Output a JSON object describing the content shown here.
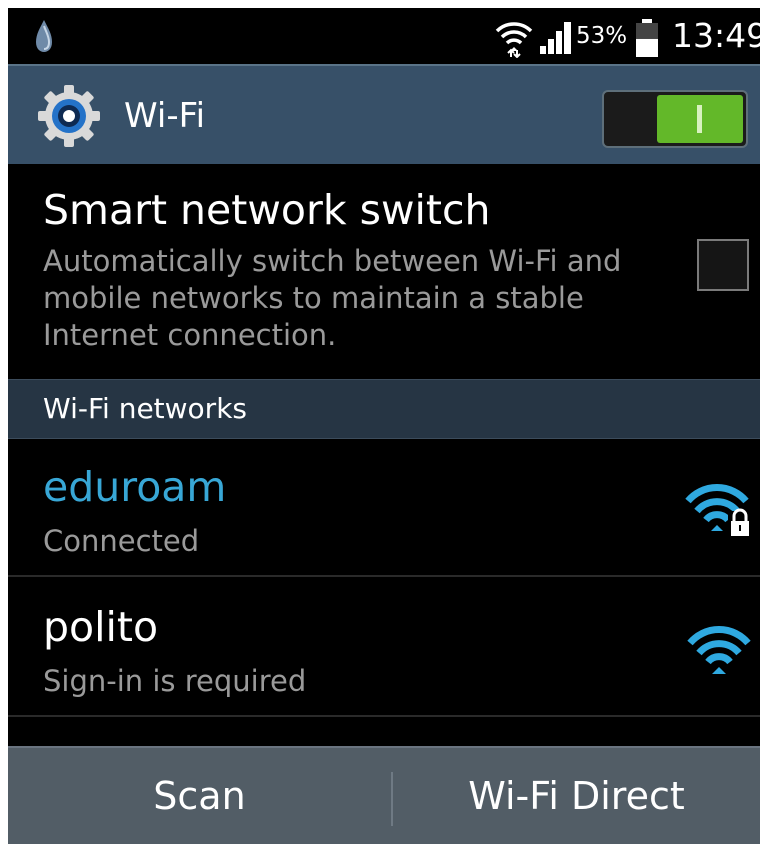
{
  "status_bar": {
    "notification_icon": "notification-drop-icon",
    "wifi_icon": "wifi-transfer-icon",
    "signal_icon": "cell-signal-icon",
    "battery_percent": "53%",
    "battery_level": 0.53,
    "time": "13:49"
  },
  "action_bar": {
    "title": "Wi-Fi",
    "icon": "gear-icon",
    "wifi_enabled": true,
    "accent": "#63b829"
  },
  "smart_switch": {
    "title": "Smart network switch",
    "description": "Automatically switch between Wi-Fi and\nmobile networks to maintain a stable\nInternet connection.",
    "checked": false
  },
  "networks_section": {
    "label": "Wi-Fi networks"
  },
  "networks": [
    {
      "ssid": "eduroam",
      "status": "Connected",
      "secured": true,
      "connected": true,
      "color": "#38a7d6",
      "icon": "wifi-lock-icon"
    },
    {
      "ssid": "polito",
      "status": "Sign-in is required",
      "secured": false,
      "connected": false,
      "icon": "wifi-icon"
    }
  ],
  "bottom_bar": {
    "scan_label": "Scan",
    "direct_label": "Wi-Fi Direct"
  }
}
